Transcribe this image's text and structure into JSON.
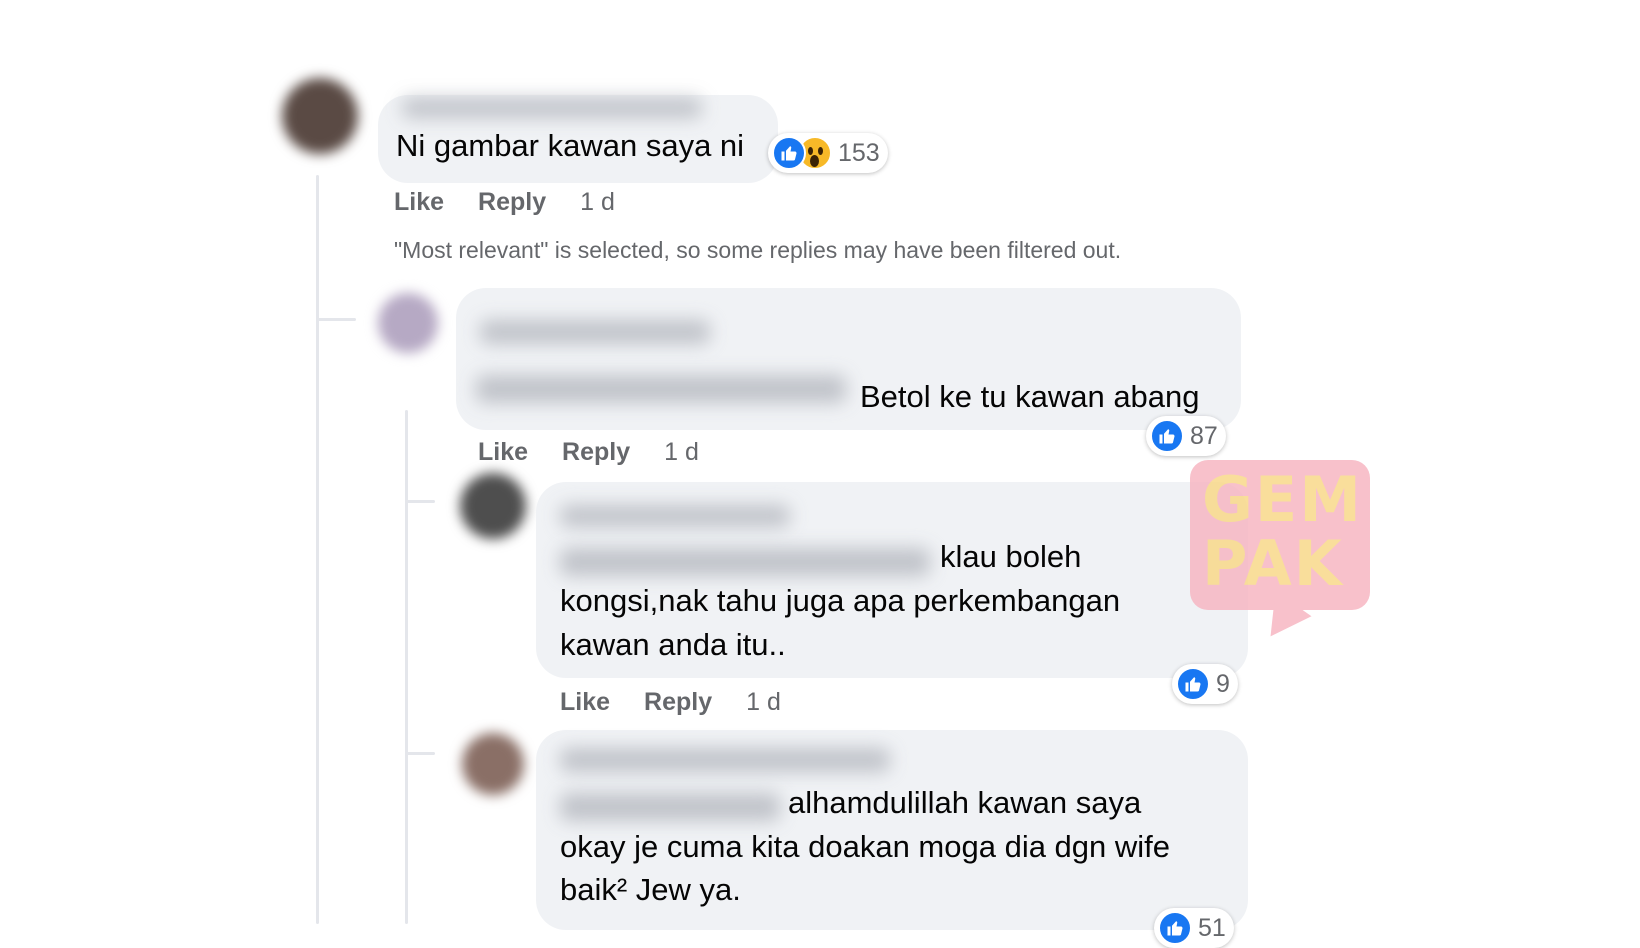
{
  "comments": [
    {
      "text": "Ni gambar kawan saya ni",
      "reaction_count": "153",
      "reactions": [
        "like-icon",
        "wow-icon"
      ],
      "actions": {
        "like": "Like",
        "reply": "Reply",
        "time": "1 d"
      }
    },
    {
      "text": "Betol ke tu kawan abang",
      "reaction_count": "87",
      "reactions": [
        "like-icon"
      ],
      "actions": {
        "like": "Like",
        "reply": "Reply",
        "time": "1 d"
      }
    },
    {
      "text_line1": "klau boleh",
      "text_line2": "kongsi,nak tahu juga apa perkembangan",
      "text_line3": "kawan anda itu..",
      "reaction_count": "9",
      "reactions": [
        "like-icon"
      ],
      "actions": {
        "like": "Like",
        "reply": "Reply",
        "time": "1 d"
      }
    },
    {
      "text_line1": "alhamdulillah kawan saya",
      "text_line2": "okay je cuma kita doakan moga dia dgn wife",
      "text_line3": "baik² Jew ya.",
      "reaction_count": "51",
      "reactions": [
        "like-icon"
      ]
    }
  ],
  "filter_note": "\"Most relevant\" is selected, so some replies may have been filtered out.",
  "watermark": {
    "line1": "GEM",
    "line2": "PAK"
  },
  "colors": {
    "bubble": "#f0f2f5",
    "like_blue": "#1877f2",
    "meta_gray": "#65676b",
    "wow_yellow": "#f7b928"
  }
}
